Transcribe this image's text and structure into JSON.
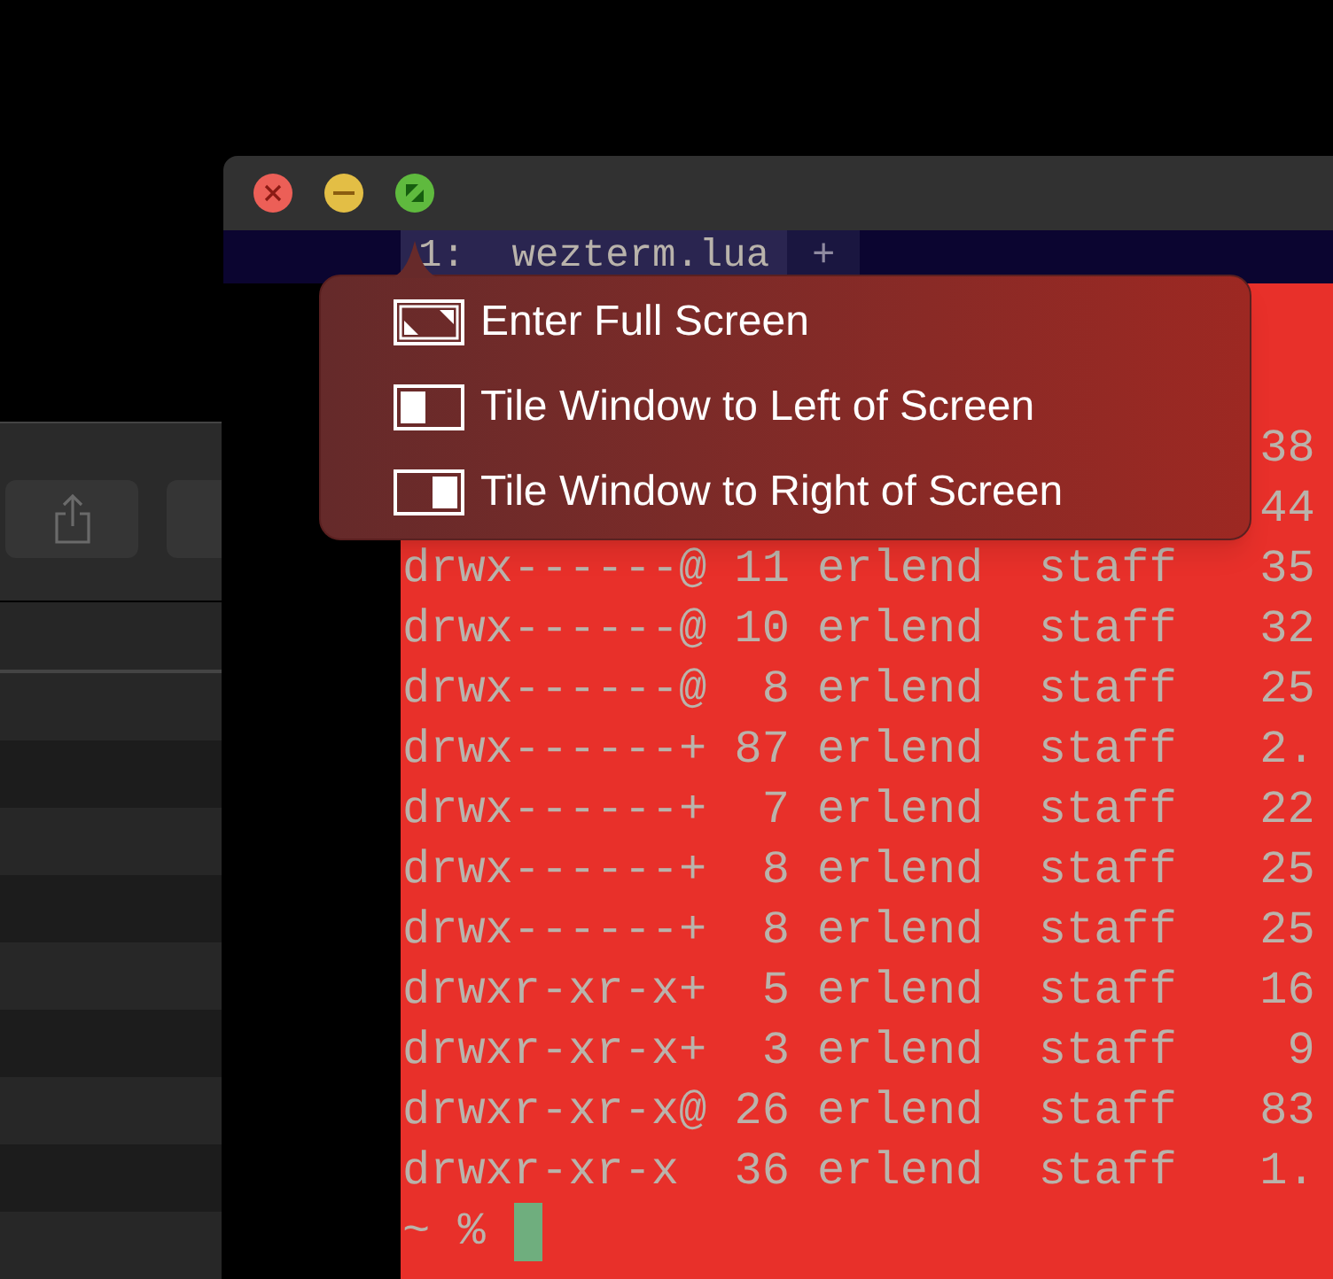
{
  "terminal_window": {
    "tabs": [
      {
        "label": "1:  wezterm.lua",
        "selected": true
      },
      {
        "label": "+",
        "selected": false
      }
    ],
    "lines": [
      {
        "kind": "partial",
        "text": "38"
      },
      {
        "kind": "partial",
        "text": "44"
      },
      {
        "kind": "full",
        "text": "drwx------@ 11 erlend  staff   35"
      },
      {
        "kind": "full",
        "text": "drwx------@ 10 erlend  staff   32"
      },
      {
        "kind": "full",
        "text": "drwx------@  8 erlend  staff   25"
      },
      {
        "kind": "full",
        "text": "drwx------+ 87 erlend  staff   2."
      },
      {
        "kind": "full",
        "text": "drwx------+  7 erlend  staff   22"
      },
      {
        "kind": "full",
        "text": "drwx------+  8 erlend  staff   25"
      },
      {
        "kind": "full",
        "text": "drwx------+  8 erlend  staff   25"
      },
      {
        "kind": "full",
        "text": "drwxr-xr-x+  5 erlend  staff   16"
      },
      {
        "kind": "full",
        "text": "drwxr-xr-x+  3 erlend  staff    9"
      },
      {
        "kind": "full",
        "text": "drwxr-xr-x@ 26 erlend  staff   83"
      },
      {
        "kind": "full",
        "text": "drwxr-xr-x  36 erlend  staff   1."
      }
    ],
    "prompt": "~ %"
  },
  "zoom_menu": [
    {
      "kind": "fullscreen",
      "label": "Enter Full Screen"
    },
    {
      "kind": "tile-left",
      "label": "Tile Window to Left of Screen"
    },
    {
      "kind": "tile-right",
      "label": "Tile Window to Right of Screen"
    }
  ]
}
